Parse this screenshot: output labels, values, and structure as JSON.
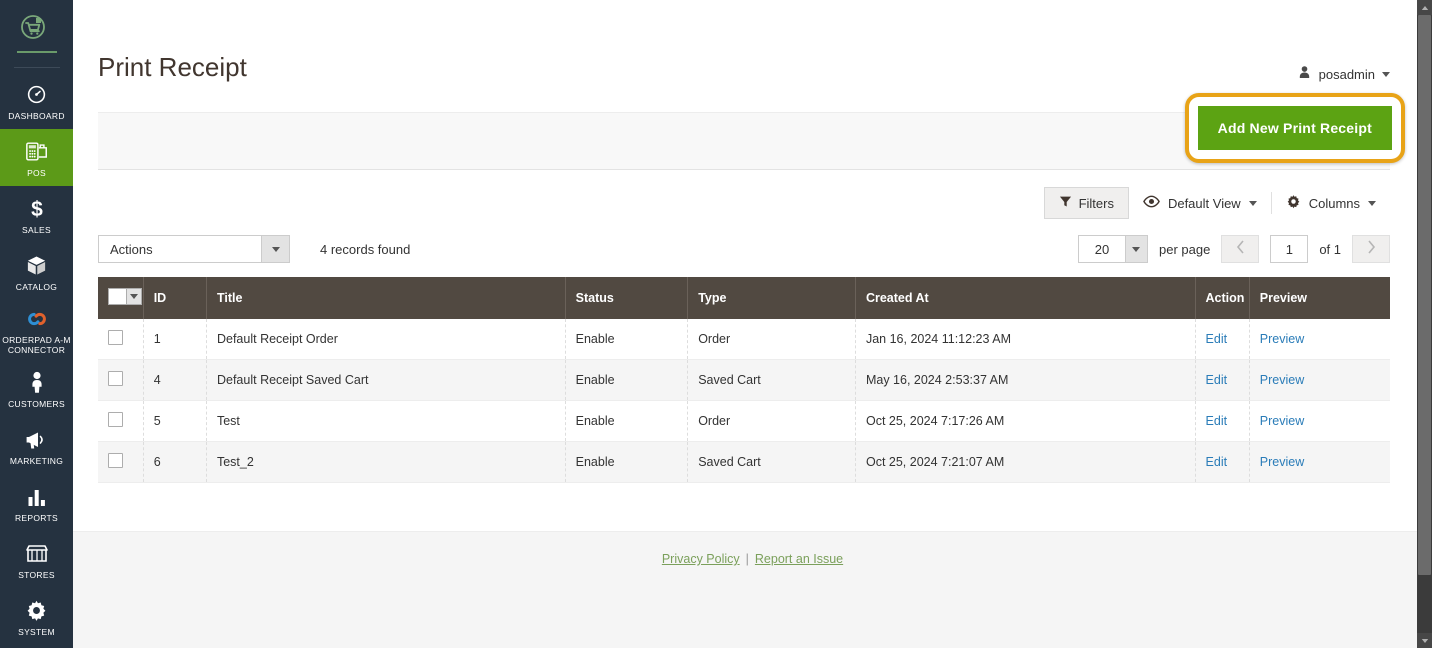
{
  "sidebar": {
    "logo_icon": "shopping-cart-logo-icon",
    "items": [
      {
        "label": "DASHBOARD",
        "icon": "gauge-icon",
        "active": false
      },
      {
        "label": "POS",
        "icon": "pos-terminal-icon",
        "active": true
      },
      {
        "label": "SALES",
        "icon": "dollar-icon",
        "active": false
      },
      {
        "label": "CATALOG",
        "icon": "box-icon",
        "active": false
      },
      {
        "label": "ORDERPAD A-M CONNECTOR",
        "icon": "link-chain-icon",
        "active": false
      },
      {
        "label": "CUSTOMERS",
        "icon": "person-icon",
        "active": false
      },
      {
        "label": "MARKETING",
        "icon": "megaphone-icon",
        "active": false
      },
      {
        "label": "REPORTS",
        "icon": "bar-chart-icon",
        "active": false
      },
      {
        "label": "STORES",
        "icon": "storefront-icon",
        "active": false
      },
      {
        "label": "SYSTEM",
        "icon": "gear-icon",
        "active": false
      }
    ]
  },
  "header": {
    "title": "Print Receipt",
    "user": "posadmin",
    "user_icon": "user-avatar-icon"
  },
  "page_actions": {
    "add_button": "Add New Print Receipt",
    "highlight_color": "#e8a317",
    "button_color": "#5ca313"
  },
  "toolbar": {
    "filters": "Filters",
    "filters_icon": "funnel-icon",
    "view": "Default View",
    "view_icon": "eye-icon",
    "columns": "Columns",
    "columns_icon": "gear-icon"
  },
  "controls": {
    "actions_label": "Actions",
    "records_found": "4 records found",
    "per_page_value": "20",
    "per_page_label": "per page",
    "prev_icon": "chevron-left-icon",
    "next_icon": "chevron-right-icon",
    "page_value": "1",
    "page_total": "of 1"
  },
  "grid": {
    "columns": [
      "",
      "ID",
      "Title",
      "Status",
      "Type",
      "Created At",
      "Action",
      "Preview"
    ],
    "rows": [
      {
        "id": "1",
        "title": "Default Receipt Order",
        "status": "Enable",
        "type": "Order",
        "created_at": "Jan 16, 2024 11:12:23 AM",
        "action": "Edit",
        "preview": "Preview"
      },
      {
        "id": "4",
        "title": "Default Receipt Saved Cart",
        "status": "Enable",
        "type": "Saved Cart",
        "created_at": "May 16, 2024 2:53:37 AM",
        "action": "Edit",
        "preview": "Preview"
      },
      {
        "id": "5",
        "title": "Test",
        "status": "Enable",
        "type": "Order",
        "created_at": "Oct 25, 2024 7:17:26 AM",
        "action": "Edit",
        "preview": "Preview"
      },
      {
        "id": "6",
        "title": "Test_2",
        "status": "Enable",
        "type": "Saved Cart",
        "created_at": "Oct 25, 2024 7:21:07 AM",
        "action": "Edit",
        "preview": "Preview"
      }
    ]
  },
  "footer": {
    "privacy": "Privacy Policy",
    "separator": "|",
    "report": "Report an Issue"
  }
}
